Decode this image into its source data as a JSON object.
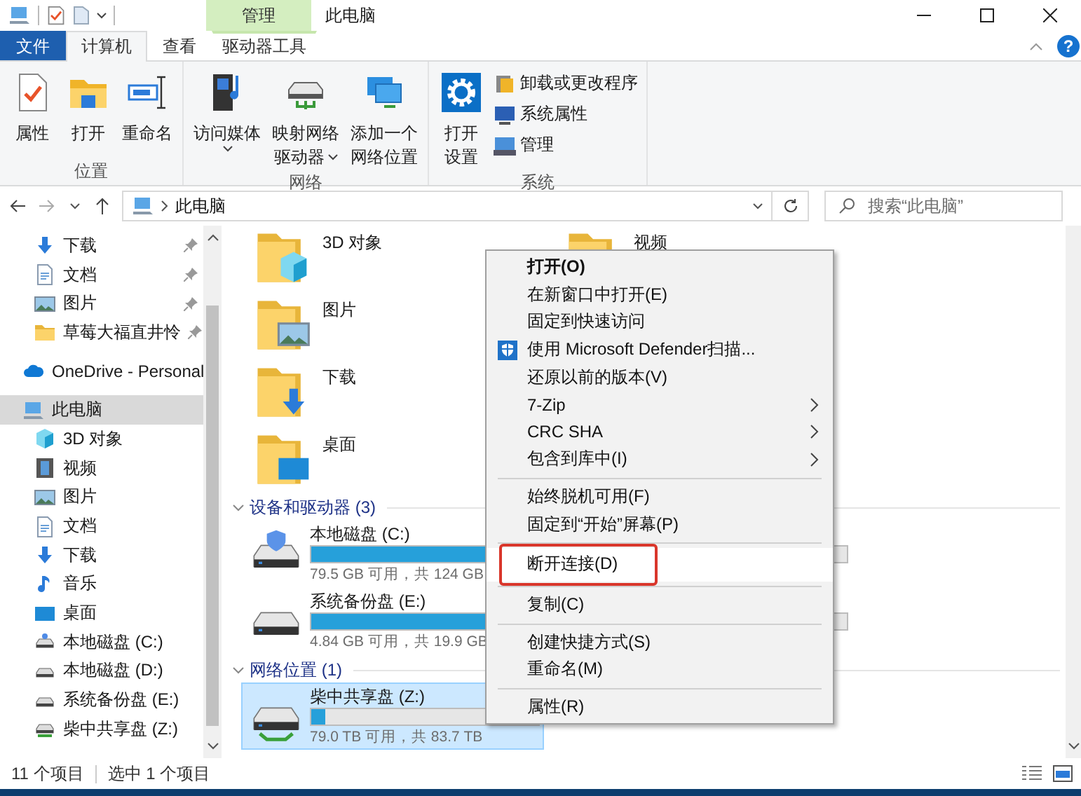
{
  "title_bar": {
    "title": "此电脑",
    "context_tab_group": "管理"
  },
  "ribbon_tabs": [
    {
      "label": "文件",
      "kind": "file",
      "selected": false
    },
    {
      "label": "计算机",
      "kind": "tab",
      "selected": true
    },
    {
      "label": "查看",
      "kind": "tab",
      "selected": false
    },
    {
      "label": "驱动器工具",
      "kind": "context",
      "selected": false
    }
  ],
  "help_button": "?",
  "ribbon_groups": [
    {
      "label": "位置",
      "buttons": [
        {
          "kind": "properties",
          "lines": [
            "属性"
          ],
          "dropdown": false
        },
        {
          "kind": "open",
          "lines": [
            "打开"
          ],
          "dropdown": false
        },
        {
          "kind": "rename",
          "lines": [
            "重命名"
          ],
          "dropdown": false
        }
      ]
    },
    {
      "label": "网络",
      "buttons": [
        {
          "kind": "media",
          "lines": [
            "访问媒体"
          ],
          "dropdown": true
        },
        {
          "kind": "map-drive",
          "lines": [
            "映射网络",
            "驱动器"
          ],
          "dropdown": true
        },
        {
          "kind": "add-location",
          "lines": [
            "添加一个",
            "网络位置"
          ],
          "dropdown": false
        }
      ]
    },
    {
      "label": "系统",
      "buttons": [
        {
          "kind": "settings",
          "lines": [
            "打开",
            "设置"
          ],
          "dropdown": false
        }
      ],
      "small_buttons": [
        {
          "kind": "uninstall",
          "label": "卸载或更改程序"
        },
        {
          "kind": "system-properties",
          "label": "系统属性"
        },
        {
          "kind": "manage",
          "label": "管理"
        }
      ]
    }
  ],
  "address_bar": {
    "path": [
      "此电脑"
    ]
  },
  "search_field": {
    "placeholder": "搜索“此电脑”"
  },
  "nav_pane": {
    "quick_access": [
      {
        "label": "下载",
        "kind": "download",
        "pinned": true,
        "selected": false
      },
      {
        "label": "文档",
        "kind": "document",
        "pinned": true,
        "selected": false
      },
      {
        "label": "图片",
        "kind": "picture",
        "pinned": true,
        "selected": false
      },
      {
        "label": "草莓大福直井怜",
        "kind": "folder",
        "pinned": true,
        "selected": false
      }
    ],
    "tree": [
      {
        "label": "OneDrive - Personal",
        "kind": "cloud",
        "selected": false
      },
      {
        "label": "此电脑",
        "kind": "pc",
        "selected": true,
        "children": [
          {
            "label": "3D 对象",
            "kind": "cube",
            "selected": false
          },
          {
            "label": "视频",
            "kind": "video",
            "selected": false
          },
          {
            "label": "图片",
            "kind": "picture",
            "selected": false
          },
          {
            "label": "文档",
            "kind": "document",
            "selected": false
          },
          {
            "label": "下载",
            "kind": "download",
            "selected": false
          },
          {
            "label": "音乐",
            "kind": "music",
            "selected": false
          },
          {
            "label": "桌面",
            "kind": "desktop",
            "selected": false
          },
          {
            "label": "本地磁盘 (C:)",
            "kind": "system-disk",
            "selected": false
          },
          {
            "label": "本地磁盘 (D:)",
            "kind": "disk",
            "selected": false
          },
          {
            "label": "系统备份盘 (E:)",
            "kind": "disk",
            "selected": false
          },
          {
            "label": "柴中共享盘 (Z:)",
            "kind": "network-drive",
            "selected": false
          }
        ]
      }
    ]
  },
  "folders": [
    {
      "label": "3D 对象",
      "kind": "cube"
    },
    {
      "label": "图片",
      "kind": "picture"
    },
    {
      "label": "下载",
      "kind": "download"
    },
    {
      "label": "桌面",
      "kind": "desktop"
    },
    {
      "label": "视频",
      "kind": "video"
    }
  ],
  "sections": [
    {
      "title": "设备和驱动器 (3)",
      "kind": "drives",
      "expanded": true,
      "items": [
        {
          "name": "本地磁盘 (C:)",
          "kind": "system-disk",
          "level": 0.36,
          "space": "79.5 GB 可用，共 124 GB",
          "selected": false
        },
        {
          "name": "系统备份盘 (E:)",
          "kind": "disk",
          "level": 0.76,
          "space": "4.84 GB 可用，共 19.9 GB",
          "selected": false
        }
      ]
    },
    {
      "title": "网络位置 (1)",
      "kind": "network",
      "expanded": true,
      "items": [
        {
          "name": "柴中共享盘 (Z:)",
          "kind": "network-drive",
          "level": 0.06,
          "space": "79.0 TB 可用，共 83.7 TB",
          "selected": true
        }
      ]
    }
  ],
  "context_menu": {
    "groups": [
      [
        {
          "label": "打开(O)",
          "kind": "default",
          "selected": false,
          "annotated": false
        },
        {
          "label": "在新窗口中打开(E)",
          "kind": "plain",
          "selected": false,
          "annotated": false
        },
        {
          "label": "固定到快速访问",
          "kind": "plain",
          "selected": false,
          "annotated": false
        },
        {
          "label": "使用 Microsoft Defender扫描...",
          "kind": "shield",
          "selected": false,
          "annotated": false
        },
        {
          "label": "还原以前的版本(V)",
          "kind": "plain",
          "selected": false,
          "annotated": false
        },
        {
          "label": "7-Zip",
          "kind": "submenu",
          "selected": false,
          "annotated": false
        },
        {
          "label": "CRC SHA",
          "kind": "submenu",
          "selected": false,
          "annotated": false
        },
        {
          "label": "包含到库中(I)",
          "kind": "submenu",
          "selected": false,
          "annotated": false
        }
      ],
      [
        {
          "label": "始终脱机可用(F)",
          "kind": "plain",
          "selected": false,
          "annotated": false
        },
        {
          "label": "固定到“开始”屏幕(P)",
          "kind": "plain",
          "selected": false,
          "annotated": false
        }
      ],
      [
        {
          "label": "断开连接(D)",
          "kind": "plain",
          "selected": true,
          "annotated": true
        }
      ],
      [
        {
          "label": "复制(C)",
          "kind": "plain",
          "selected": false,
          "annotated": false
        }
      ],
      [
        {
          "label": "创建快捷方式(S)",
          "kind": "plain",
          "selected": false,
          "annotated": false
        },
        {
          "label": "重命名(M)",
          "kind": "plain",
          "selected": false,
          "annotated": false
        }
      ],
      [
        {
          "label": "属性(R)",
          "kind": "plain",
          "selected": false,
          "annotated": false
        }
      ]
    ]
  },
  "status_bar": {
    "item_count": "11 个项目",
    "selection": "选中 1 个项目"
  }
}
